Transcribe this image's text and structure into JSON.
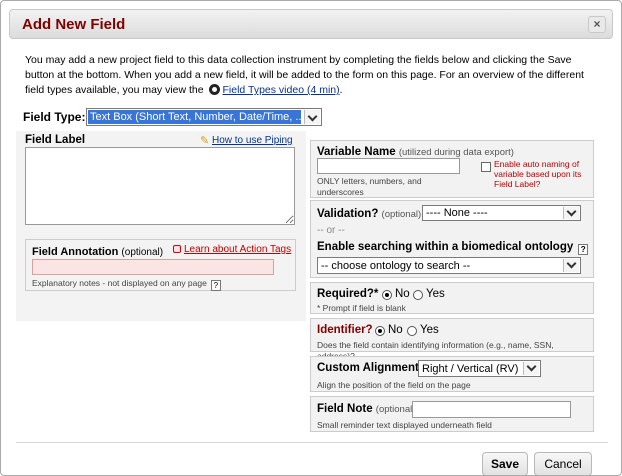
{
  "dialog": {
    "title": "Add New Field",
    "close_label": "×"
  },
  "intro": {
    "text_part1": "You may add a new project field to this data collection instrument by completing the fields below and clicking the Save button at the bottom. When you add a new field, it will be added to the form on this page. For an overview of the different field types available, you may view the",
    "video_link": "Field Types video (4 min)",
    "text_end": "."
  },
  "field_type": {
    "label": "Field Type:",
    "value": "Text Box (Short Text, Number, Date/Time, ...)"
  },
  "field_label": {
    "label": "Field Label",
    "piping_link": "How to use Piping"
  },
  "annotation": {
    "label": "Field Annotation",
    "optional": "(optional)",
    "tags_link": "Learn about Action Tags",
    "hint": "Explanatory notes - not displayed on any page",
    "help": "?"
  },
  "variable": {
    "label": "Variable Name",
    "sub": "(utilized during data export)",
    "hint": "ONLY letters, numbers, and underscores",
    "auto_name": "Enable auto naming of variable based upon its Field Label?"
  },
  "validation": {
    "label": "Validation?",
    "optional": "(optional)",
    "value": "---- None ----",
    "or": "-- or --",
    "ontology_label": "Enable searching within a biomedical ontology",
    "ontology_help": "?",
    "ontology_value": "-- choose ontology to search --"
  },
  "required": {
    "label": "Required?*",
    "yes": "Yes",
    "no": "No",
    "hint": "* Prompt if field is blank"
  },
  "identifier": {
    "label": "Identifier?",
    "yes": "Yes",
    "no": "No",
    "hint": "Does the field contain identifying information (e.g., name, SSN, address)?"
  },
  "alignment": {
    "label": "Custom Alignment",
    "value": "Right / Vertical (RV)",
    "hint": "Align the position of the field on the page"
  },
  "field_note": {
    "label": "Field Note",
    "optional": "(optional)",
    "hint": "Small reminder text displayed underneath field"
  },
  "footer": {
    "save": "Save",
    "cancel": "Cancel"
  },
  "colors": {
    "title": "#800000",
    "link": "#00339a",
    "selection": "#3875d7",
    "annotation_input": "#fbe4e4",
    "identifier_label": "#800000"
  }
}
